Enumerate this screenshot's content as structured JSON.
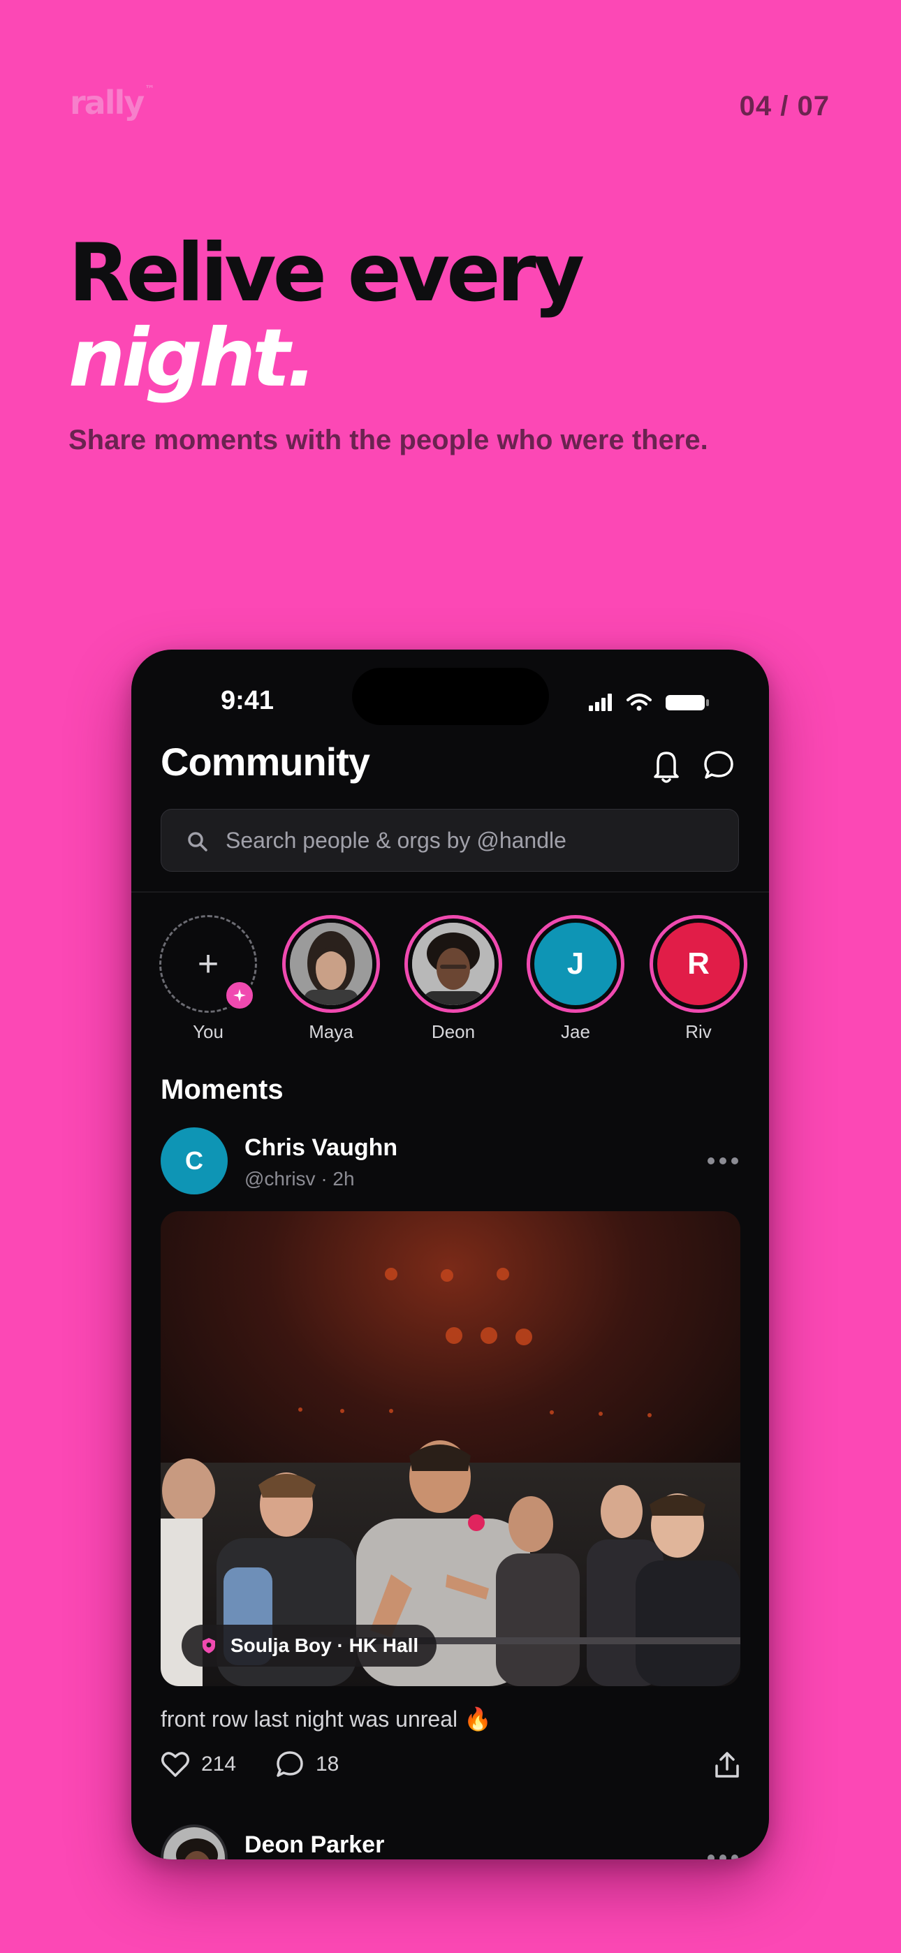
{
  "brand": {
    "name": "rally",
    "mark": "™"
  },
  "pager": "04 / 07",
  "headline": {
    "line1": "Relive every",
    "line2": "night."
  },
  "subtitle": "Share moments with the people who were there.",
  "phone": {
    "status_time": "9:41",
    "title": "Community",
    "search": {
      "placeholder": "Search people & orgs by @handle"
    },
    "stories": [
      {
        "label": "You",
        "type": "add"
      },
      {
        "label": "Maya",
        "type": "photo"
      },
      {
        "label": "Deon",
        "type": "photo"
      },
      {
        "label": "Jae",
        "initial": "J",
        "color": "#0e95b5"
      },
      {
        "label": "Riv",
        "initial": "R",
        "color": "#e11d48"
      }
    ],
    "section_title": "Moments",
    "post": {
      "avatar_initial": "C",
      "avatar_color": "#0e95b5",
      "name": "Chris Vaughn",
      "meta": "@chrisv · 2h",
      "tag": "Soulja Boy · HK Hall",
      "caption": "front row last night was unreal 🔥",
      "likes": "214",
      "comments": "18"
    },
    "next_post": {
      "name": "Deon Parker"
    }
  },
  "colors": {
    "background": "#fc48b5",
    "accent": "#f04ab0",
    "phone_bg": "#0a0a0c"
  }
}
